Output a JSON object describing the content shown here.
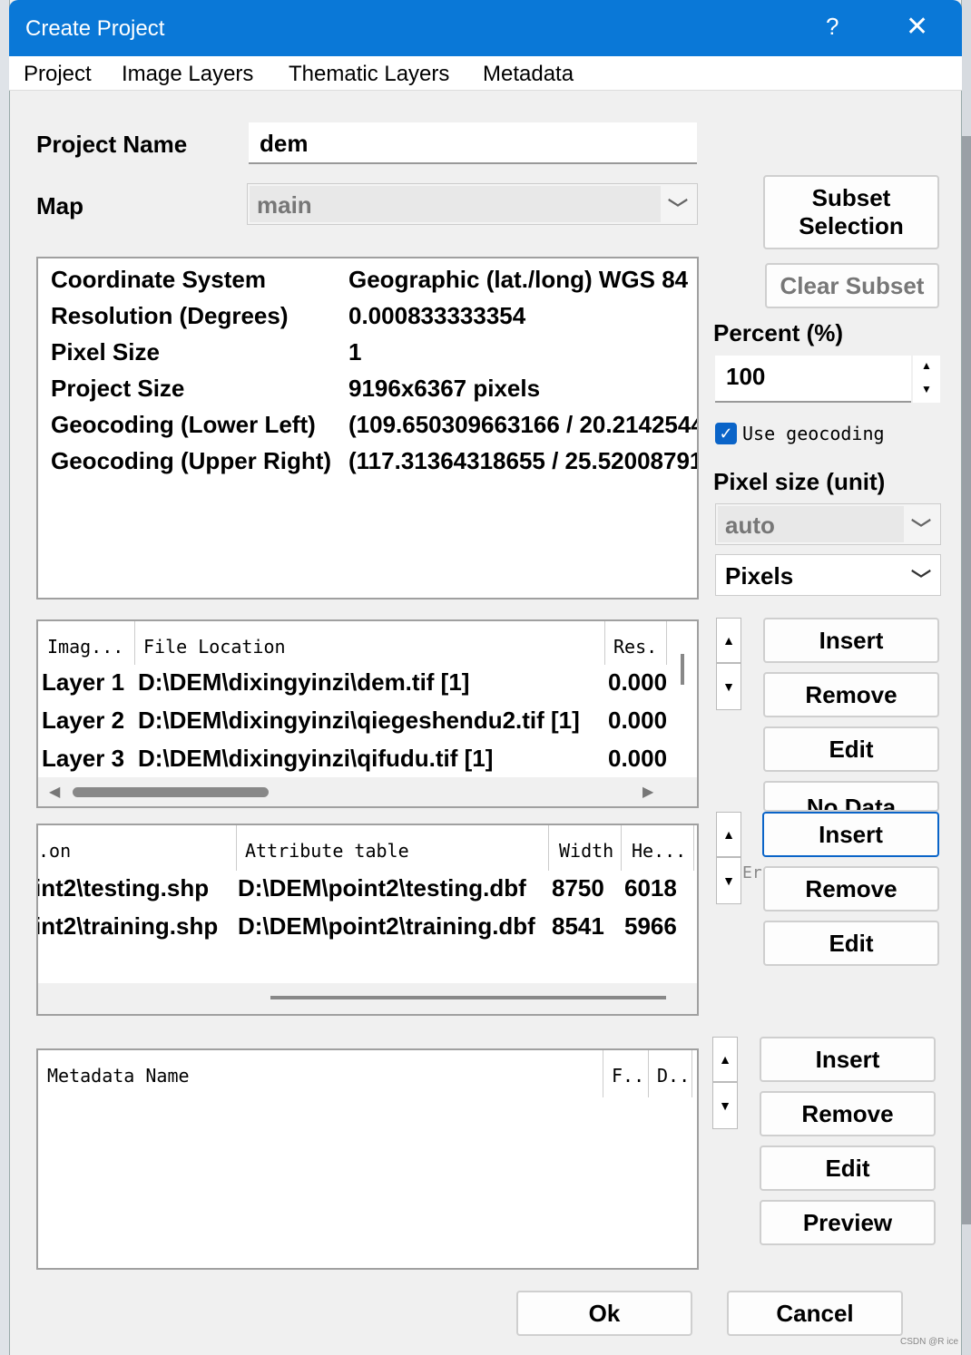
{
  "window": {
    "title": "Create Project",
    "help": "?",
    "close": "✕"
  },
  "menu": [
    "Project",
    "Image Layers",
    "Thematic Layers",
    "Metadata"
  ],
  "project": {
    "name_label": "Project Name",
    "name_value": "dem",
    "map_label": "Map",
    "map_value": "main"
  },
  "info": [
    {
      "key": "Coordinate System",
      "value": "Geographic (lat./long)  WGS 84"
    },
    {
      "key": "Resolution (Degrees)",
      "value": "0.000833333354"
    },
    {
      "key": "Pixel Size",
      "value": "1"
    },
    {
      "key": "Project Size",
      "value": "9196x6367 pixels"
    },
    {
      "key": "Geocoding (Lower Left)",
      "value": "(109.650309663166 / 20.2142544"
    },
    {
      "key": "Geocoding (Upper Right)",
      "value": "(117.31364318655 / 25.52008791"
    }
  ],
  "subset": {
    "selection": "Subset Selection",
    "clear": "Clear Subset",
    "percent_label": "Percent (%)",
    "percent_value": "100",
    "use_geocoding": "Use geocoding",
    "pixel_size_label": "Pixel size (unit)",
    "pixel_size_value": "auto",
    "unit_value": "Pixels"
  },
  "image_layers": {
    "headers": [
      "Imag...",
      "File Location",
      "Res."
    ],
    "rows": [
      [
        "Layer 1",
        "D:\\DEM\\dixingyinzi\\dem.tif [1]",
        "0.000"
      ],
      [
        "Layer 2",
        "D:\\DEM\\dixingyinzi\\qiegeshendu2.tif [1]",
        "0.000"
      ],
      [
        "Layer 3",
        "D:\\DEM\\dixingyinzi\\qifudu.tif [1]",
        "0.000"
      ]
    ],
    "buttons": {
      "insert": "Insert",
      "remove": "Remove",
      "edit": "Edit",
      "nodata": "No Data"
    }
  },
  "thematic_layers": {
    "headers": [
      ".on",
      "Attribute table",
      "Width",
      "He..."
    ],
    "rows": [
      [
        "int2\\testing.shp",
        "D:\\DEM\\point2\\testing.dbf",
        "8750",
        "6018"
      ],
      [
        "int2\\training.shp",
        "D:\\DEM\\point2\\training.dbf",
        "8541",
        "5966"
      ]
    ],
    "side_hint": "Er",
    "buttons": {
      "insert": "Insert",
      "remove": "Remove",
      "edit": "Edit"
    }
  },
  "metadata": {
    "headers": [
      "Metadata Name",
      "F..",
      "D.."
    ],
    "buttons": {
      "insert": "Insert",
      "remove": "Remove",
      "edit": "Edit",
      "preview": "Preview"
    }
  },
  "footer": {
    "ok": "Ok",
    "cancel": "Cancel"
  },
  "watermark": "CSDN @R ice",
  "colors": {
    "titlebar": "#0a78d7",
    "focus": "#0a64c8"
  }
}
